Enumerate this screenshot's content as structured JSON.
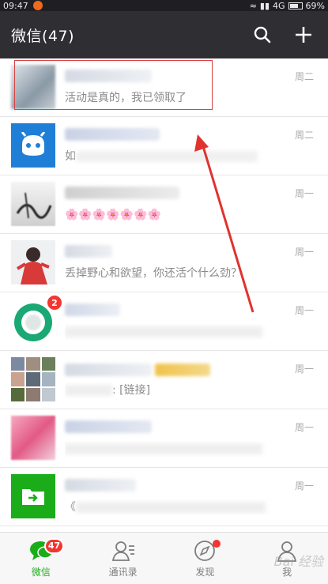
{
  "status_bar": {
    "time": "09:47",
    "network": "4G",
    "battery": "69%",
    "battery_level": 0.69
  },
  "header": {
    "title": "微信(47)",
    "search_icon": "search-icon",
    "add_icon": "plus-icon"
  },
  "chats": [
    {
      "message": "活动是真的，我已领取了",
      "time": "周二",
      "avatar_color": "#9aa6b2"
    },
    {
      "message": "如",
      "time": "周二",
      "avatar_color": "#1f7fd6"
    },
    {
      "message": "🌸🌸🌸🌸🌸🌸🌸",
      "time": "周一",
      "avatar_color": "#cfcfcf"
    },
    {
      "message": "丢掉野心和欲望，你还活个什么劲？",
      "time": "周一",
      "avatar_color": "#d83a3a"
    },
    {
      "message": "",
      "time": "周一",
      "avatar_color": "#1aa874",
      "badge": "2"
    },
    {
      "message": ": [链接]",
      "time": "周一",
      "avatar_color": "#8c7d74"
    },
    {
      "message": "",
      "time": "周一",
      "avatar_color": "#e25a86"
    },
    {
      "message": "《",
      "time": "周一",
      "avatar_color": "#1aad19"
    }
  ],
  "tabs": [
    {
      "label": "微信",
      "badge": "47",
      "active": true
    },
    {
      "label": "通讯录"
    },
    {
      "label": "发现",
      "dot": true
    },
    {
      "label": "我"
    }
  ],
  "watermark": "Bai 经验",
  "colors": {
    "header_bg": "#2e2e33",
    "accent_green": "#1aad19",
    "badge_red": "#f43530"
  }
}
